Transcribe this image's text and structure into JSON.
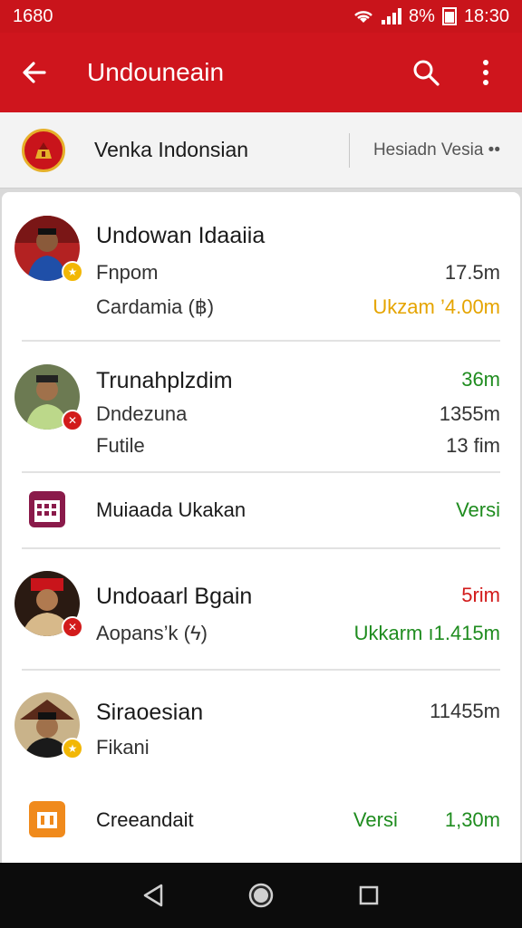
{
  "status_bar": {
    "left_text": "1680",
    "battery_text": "8%",
    "time": "18:30"
  },
  "app_bar": {
    "title": "Undouneain",
    "icons": [
      "back-arrow-icon",
      "search-icon",
      "more-vert-icon"
    ]
  },
  "channel": {
    "name": "Venka Indonsian",
    "version_label": "Hesiadn Vesia ••"
  },
  "items": [
    {
      "title": "Undowan Idaaiia",
      "rows": [
        {
          "label": "Fnpom",
          "value": "17.5m"
        },
        {
          "label": "Cardamia (฿)",
          "value": "Ukzam ’4.00m"
        }
      ],
      "badge_color": "#f2b705"
    },
    {
      "title": "Trunahplzdim",
      "title_value": "36m",
      "rows": [
        {
          "label": "Dndezuna",
          "value": "1355m"
        },
        {
          "label": "Futile",
          "value": "13 fim"
        }
      ],
      "badge_color": "#d21b1b"
    },
    {
      "title": "Muiaada Ukakan",
      "value": "Versi"
    },
    {
      "title": "Undoaarl Bgain",
      "title_value": "5rim",
      "rows": [
        {
          "label": "Aopans’k (ϟ)",
          "value": "Ukkarm ı1.415m"
        }
      ],
      "badge_color": "#d21b1b"
    },
    {
      "title": "Siraoesian",
      "title_value": "11455m",
      "rows": [
        {
          "label": "Fikani",
          "value": ""
        }
      ],
      "badge_color": "#f2b705"
    },
    {
      "title": "Creeandait",
      "value": "Versi",
      "value2": "1,30m"
    }
  ],
  "colors": {
    "brand_red": "#cf151d",
    "yellow": "#e5a400",
    "green": "#1f8c1f"
  },
  "nav_icons": [
    "back-triangle-icon",
    "home-circle-icon",
    "recents-square-icon"
  ]
}
